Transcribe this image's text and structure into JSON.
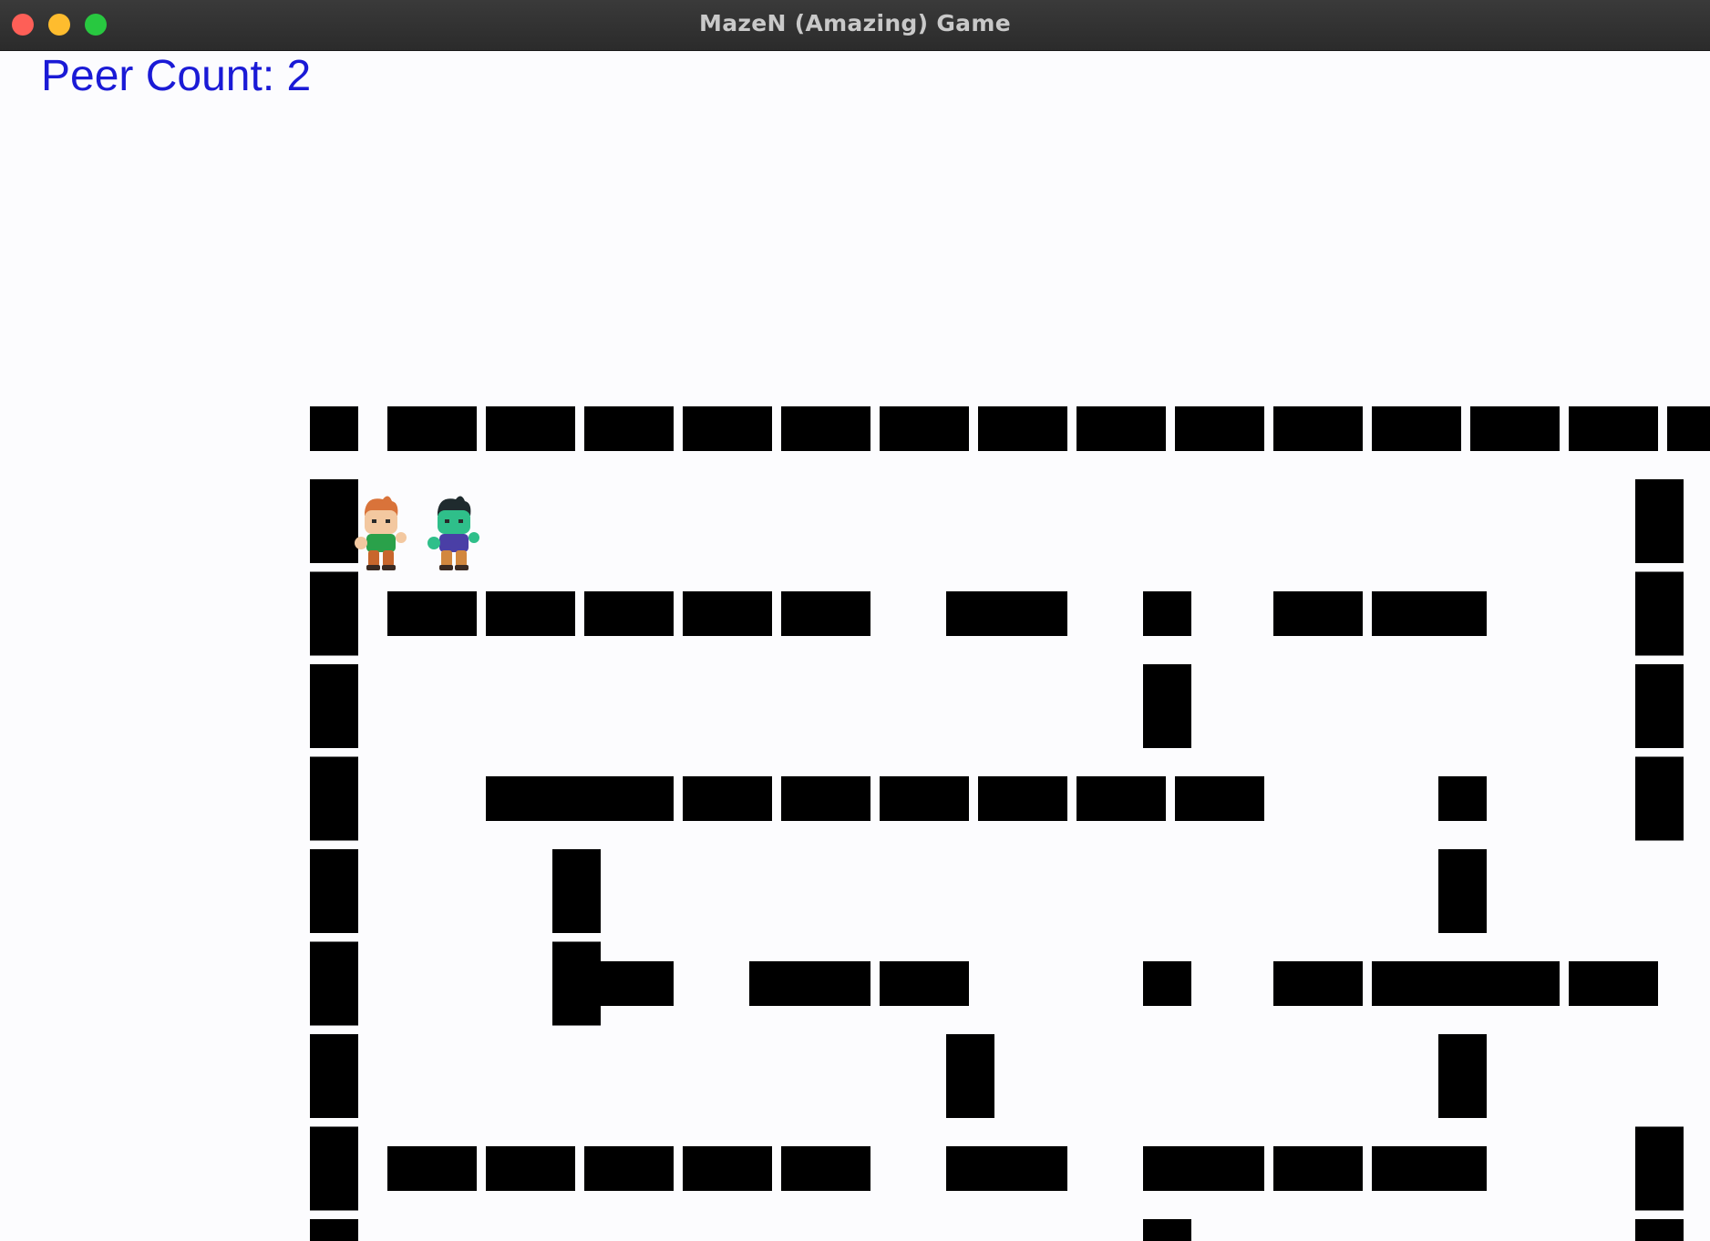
{
  "window": {
    "title": "MazeN (Amazing) Game",
    "controls": {
      "close_color": "#fe5f57",
      "minimize_color": "#febc2e",
      "maximize_color": "#28c840"
    }
  },
  "hud": {
    "peer_count_label": "Peer Count: 2",
    "text_color": "#1a1ad6"
  },
  "maze": {
    "wall_color": "#000000",
    "floor_color": "#fcfcfe",
    "horizontal_walls": [
      [
        0,
        1,
        1,
        1,
        1,
        1,
        1,
        1,
        1,
        1,
        1,
        1,
        1,
        1,
        1
      ],
      [
        0,
        1,
        1,
        1,
        1,
        1,
        0,
        1,
        0,
        0,
        1,
        1,
        0,
        0,
        0
      ],
      [
        0,
        0,
        1,
        1,
        1,
        1,
        1,
        1,
        1,
        1,
        0,
        0,
        0,
        0,
        0
      ],
      [
        0,
        0,
        0,
        1,
        0,
        1,
        1,
        0,
        0,
        0,
        1,
        1,
        1,
        1,
        0
      ],
      [
        0,
        1,
        1,
        1,
        1,
        1,
        0,
        1,
        0,
        1,
        1,
        1,
        0,
        0,
        0
      ]
    ],
    "vertical_walls": [
      [
        1,
        0,
        0,
        0,
        0,
        0,
        0,
        0,
        0,
        0,
        0,
        0,
        0,
        1,
        0
      ],
      [
        1,
        0,
        0,
        0,
        0,
        0,
        0,
        0,
        0,
        0,
        0,
        0,
        0,
        1,
        0
      ],
      [
        1,
        0,
        0,
        0,
        0,
        0,
        0,
        0,
        1,
        0,
        0,
        0,
        0,
        1,
        1
      ],
      [
        1,
        0,
        0,
        0,
        0,
        0,
        0,
        0,
        0,
        0,
        0,
        0,
        0,
        1,
        1
      ],
      [
        1,
        0,
        1,
        0,
        0,
        0,
        0,
        0,
        0,
        0,
        0,
        1,
        0,
        0,
        1
      ],
      [
        1,
        0,
        1,
        0,
        0,
        0,
        0,
        0,
        0,
        0,
        0,
        0,
        0,
        0,
        1
      ],
      [
        1,
        0,
        0,
        0,
        0,
        0,
        1,
        0,
        0,
        0,
        0,
        1,
        0,
        0,
        1
      ],
      [
        1,
        0,
        0,
        0,
        0,
        0,
        0,
        0,
        0,
        0,
        0,
        0,
        0,
        1,
        1
      ],
      [
        1,
        0,
        0,
        0,
        0,
        0,
        0,
        0,
        1,
        0,
        0,
        0,
        0,
        1,
        0
      ]
    ],
    "post_rows": [
      [
        1,
        0,
        0,
        0,
        0,
        0,
        0,
        0,
        0,
        0,
        0,
        0,
        0,
        0,
        1
      ],
      [
        1,
        0,
        0,
        0,
        0,
        0,
        1,
        0,
        1,
        0,
        0,
        1,
        0,
        0,
        1
      ],
      [
        1,
        0,
        1,
        0,
        0,
        0,
        0,
        0,
        0,
        0,
        0,
        1,
        0,
        0,
        1
      ],
      [
        1,
        0,
        1,
        0,
        1,
        0,
        0,
        0,
        1,
        0,
        0,
        1,
        0,
        0,
        1
      ],
      [
        1,
        0,
        0,
        0,
        0,
        0,
        1,
        0,
        1,
        0,
        0,
        1,
        0,
        0,
        1
      ]
    ]
  },
  "players": [
    {
      "name": "player-red-hair",
      "hair": "#d9733a",
      "skin": "#f3c8a0",
      "shirt": "#2aa14a",
      "pants": "#c8662c"
    },
    {
      "name": "player-green-zombie",
      "hair": "#1f2b2e",
      "skin": "#2fbf8a",
      "shirt": "#4a3fa6",
      "pants": "#d2873e"
    }
  ]
}
